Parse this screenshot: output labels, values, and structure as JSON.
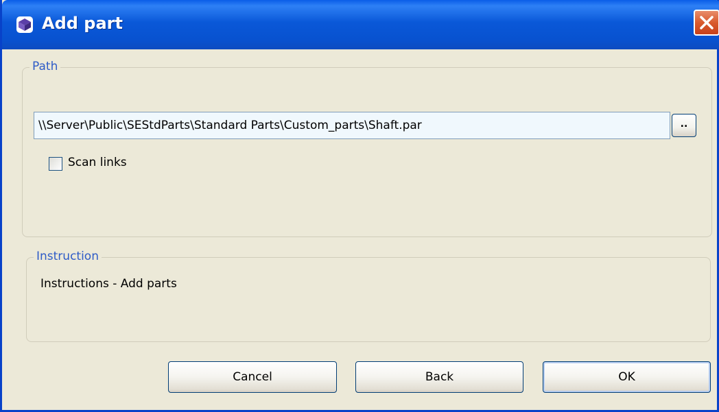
{
  "window": {
    "title": "Add part",
    "title_icon": "part-icon",
    "close_icon": "close-icon"
  },
  "path_group": {
    "legend": "Path",
    "path_value": "\\\\Server\\Public\\SEStdParts\\Standard Parts\\Custom_parts\\Shaft.par",
    "browse_label": "..",
    "scan_links_label": "Scan links",
    "scan_links_checked": false
  },
  "instruction_group": {
    "legend": "Instruction",
    "text": "Instructions - Add parts"
  },
  "buttons": {
    "cancel": "Cancel",
    "back": "Back",
    "ok": "OK"
  },
  "colors": {
    "titlebar": "#0A58D8",
    "dialog_bg": "#ECE9D8",
    "legend": "#2E5BC7",
    "close_button": "#D95B2E"
  }
}
